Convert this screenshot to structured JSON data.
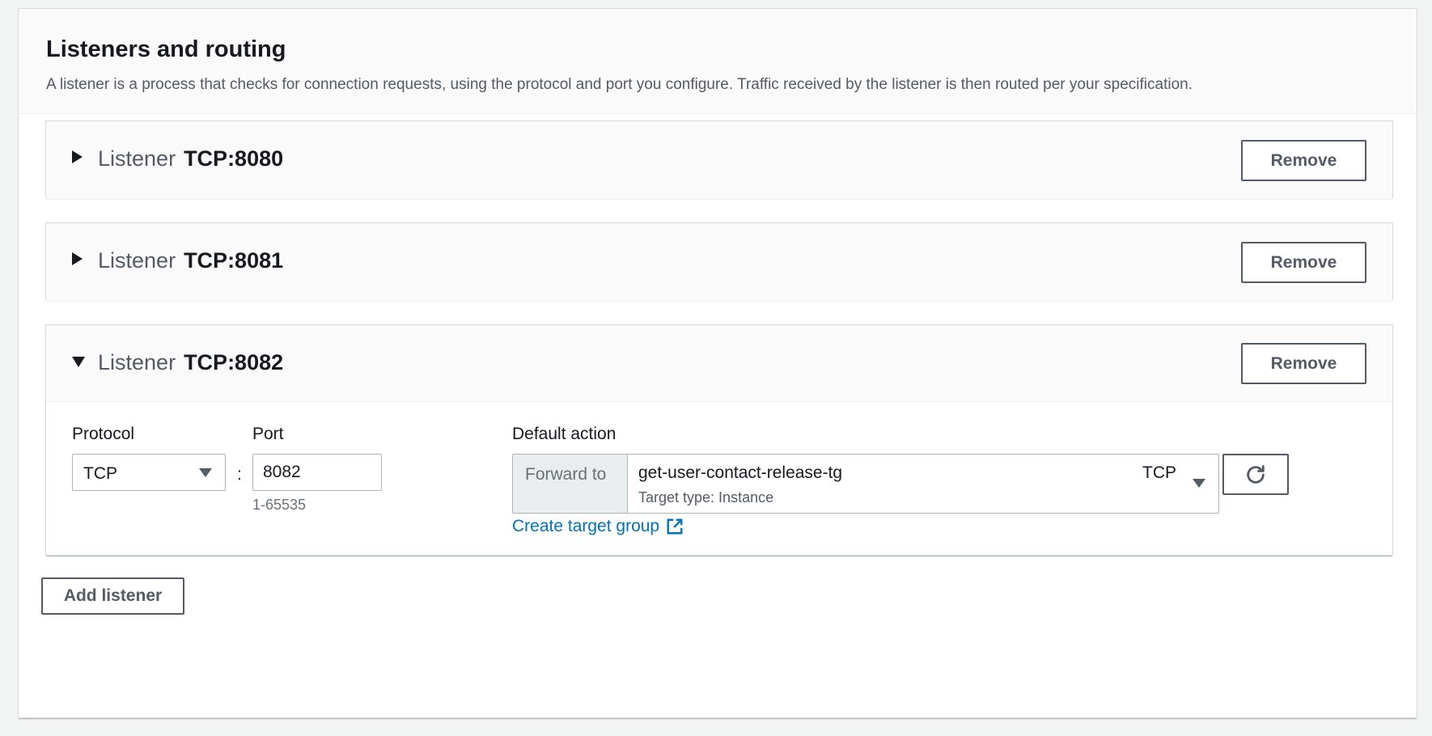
{
  "section": {
    "title": "Listeners and routing",
    "description": "A listener is a process that checks for connection requests, using the protocol and port you configure. Traffic received by the listener is then routed per your specification."
  },
  "listeners": [
    {
      "keyword": "Listener",
      "value": "TCP:8080",
      "expanded": false,
      "remove_label": "Remove"
    },
    {
      "keyword": "Listener",
      "value": "TCP:8081",
      "expanded": false,
      "remove_label": "Remove"
    },
    {
      "keyword": "Listener",
      "value": "TCP:8082",
      "expanded": true,
      "remove_label": "Remove"
    }
  ],
  "listener_form": {
    "protocol_label": "Protocol",
    "protocol_value": "TCP",
    "colon": ":",
    "port_label": "Port",
    "port_value": "8082",
    "port_hint": "1-65535",
    "default_action_label": "Default action",
    "forward_label": "Forward to",
    "target_group_name": "get-user-contact-release-tg",
    "target_group_type": "Target type: Instance",
    "target_group_protocol": "TCP",
    "create_link": "Create target group"
  },
  "add_listener_label": "Add listener",
  "icons": {
    "collapsed": "caret-right-icon",
    "expanded": "caret-down-icon",
    "dropdown": "triangle-down-icon",
    "refresh": "refresh-icon",
    "external": "external-link-icon"
  },
  "colors": {
    "link": "#0073bb",
    "border": "#aab7b8",
    "button_border": "#545b64",
    "header_bg": "#fafafa"
  }
}
